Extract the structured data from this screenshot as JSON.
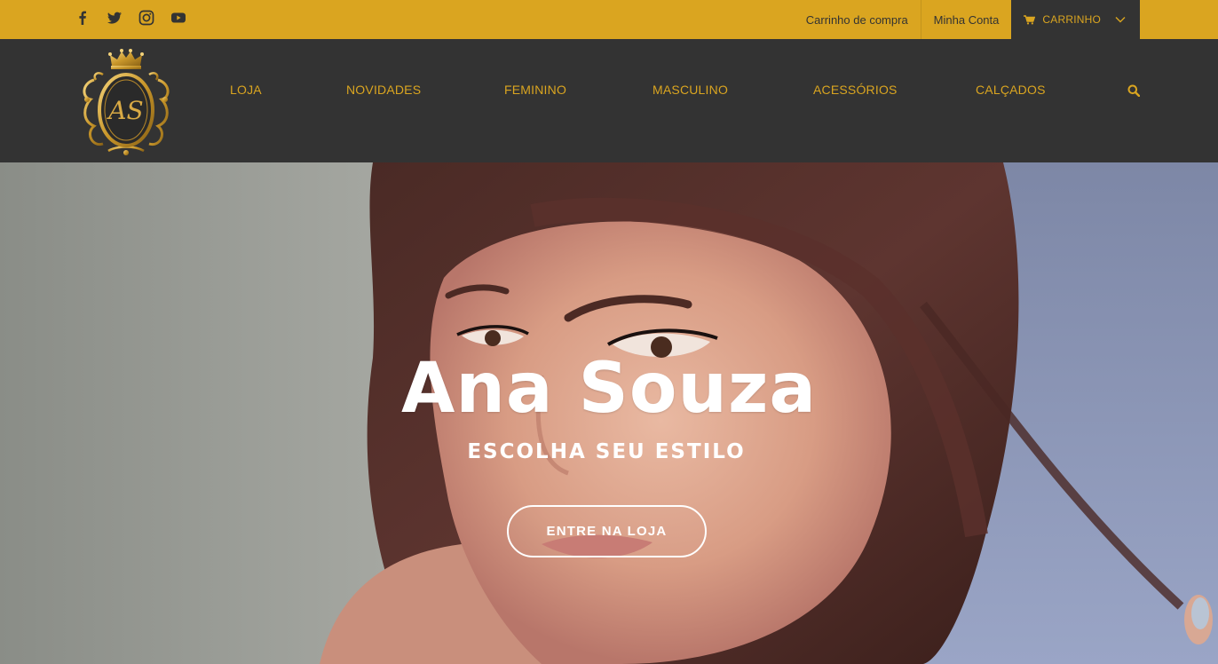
{
  "colors": {
    "accent": "#daa520",
    "dark": "#333333",
    "white": "#ffffff"
  },
  "topbar": {
    "social": [
      {
        "icon": "facebook-icon"
      },
      {
        "icon": "twitter-icon"
      },
      {
        "icon": "instagram-icon"
      },
      {
        "icon": "youtube-icon"
      }
    ],
    "links": {
      "cart_page": "Carrinho de compra",
      "account": "Minha Conta"
    },
    "cart_button": {
      "label": "CARRINHO",
      "icon": "cart-icon",
      "caret": "chevron-down-icon"
    }
  },
  "header": {
    "logo": {
      "letters": "AS"
    },
    "menu": [
      "LOJA",
      "NOVIDADES",
      "FEMININO",
      "MASCULINO",
      "ACESSÓRIOS",
      "CALÇADOS"
    ],
    "search_icon": "search-icon"
  },
  "hero": {
    "title": "Ana Souza",
    "subtitle": "ESCOLHA SEU ESTILO",
    "button": "ENTRE NA LOJA"
  }
}
